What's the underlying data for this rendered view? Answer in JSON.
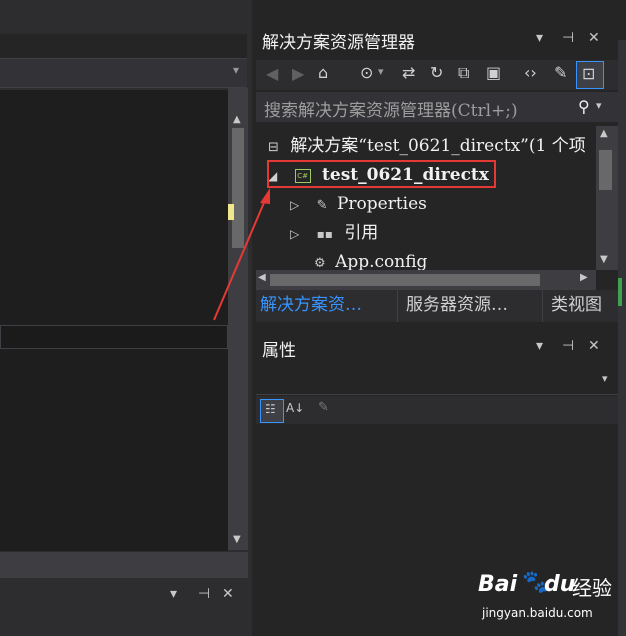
{
  "solution_explorer": {
    "title": "解决方案资源管理器",
    "search_placeholder": "搜索解决方案资源管理器(Ctrl+;)",
    "tree": {
      "solution": "解决方案“test_0621_directx”(1 个项",
      "project": "test_0621_directx",
      "properties": "Properties",
      "references": "引用",
      "app_config": "App.config"
    },
    "tabs": [
      "解决方案资…",
      "服务器资源…",
      "类视图"
    ]
  },
  "properties_panel": {
    "title": "属性"
  },
  "window_controls": {
    "dropdown": "▾",
    "pin": "⊣",
    "close": "✕"
  },
  "watermark": {
    "brand": "Bai",
    "brand2": "du",
    "sub": "经验",
    "url": "jingyan.baidu.com"
  },
  "colors": {
    "accent_blue": "#3794ff",
    "highlight_red": "#e53935",
    "bg": "#252526"
  }
}
